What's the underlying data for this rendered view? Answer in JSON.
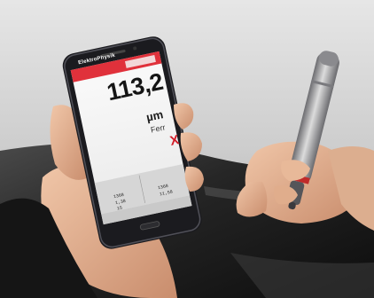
{
  "phone_app": {
    "brand": "ElektroPhysik",
    "brand_sub": "",
    "reading_value": "113,2",
    "reading_unit": "µm",
    "reading_mode": "Ferr",
    "delete_symbol": "X",
    "stats": {
      "n_value": "1368",
      "n_value_2": "1368",
      "stat_2": "1,38",
      "stat_3": "11,58",
      "stat_4": "15"
    }
  },
  "colors": {
    "app_header": "#e0313b",
    "phone_body": "#1b1b1f",
    "probe_body": "#9a9a9e",
    "probe_ring": "#c02a2a",
    "car_surface": "#1a1a1a",
    "background": "#d6d6d6",
    "skin": "#e2b394"
  },
  "scene": {
    "left_hand": "hand holding smartphone",
    "right_hand": "hand holding coating thickness probe"
  }
}
